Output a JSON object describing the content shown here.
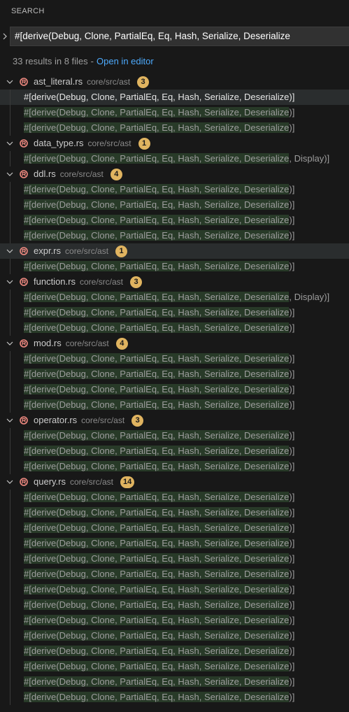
{
  "header": {
    "title": "SEARCH"
  },
  "search": {
    "query": "#[derive(Debug, Clone, PartialEq, Eq, Hash, Serialize, Deserialize"
  },
  "summary": {
    "text": "33 results in 8 files",
    "separator": "-",
    "open_in_editor": "Open in editor"
  },
  "colors": {
    "match_highlight": "#2f3e2e",
    "badge": "#e0b460",
    "link": "#4daafc",
    "error_icon": "#f28b82"
  },
  "groups": [
    {
      "file": "ast_literal.rs",
      "path": "core/src/ast",
      "count": "3",
      "highlighted": false,
      "matches": [
        {
          "match": "#[derive(Debug, Clone, PartialEq, Eq, Hash, Serialize, Deserialize",
          "after": ")]",
          "active": true,
          "highlighted": true
        },
        {
          "match": "#[derive(Debug, Clone, PartialEq, Eq, Hash, Serialize, Deserialize",
          "after": ")]",
          "active": false,
          "highlighted": false
        },
        {
          "match": "#[derive(Debug, Clone, PartialEq, Eq, Hash, Serialize, Deserialize",
          "after": ")]",
          "active": false,
          "highlighted": false
        }
      ]
    },
    {
      "file": "data_type.rs",
      "path": "core/src/ast",
      "count": "1",
      "highlighted": false,
      "matches": [
        {
          "match": "#[derive(Debug, Clone, PartialEq, Eq, Hash, Serialize, Deserialize",
          "after": ", Display)]",
          "active": false,
          "highlighted": false
        }
      ]
    },
    {
      "file": "ddl.rs",
      "path": "core/src/ast",
      "count": "4",
      "highlighted": false,
      "matches": [
        {
          "match": "#[derive(Debug, Clone, PartialEq, Eq, Hash, Serialize, Deserialize",
          "after": ")]",
          "active": false,
          "highlighted": false
        },
        {
          "match": "#[derive(Debug, Clone, PartialEq, Eq, Hash, Serialize, Deserialize",
          "after": ")]",
          "active": false,
          "highlighted": false
        },
        {
          "match": "#[derive(Debug, Clone, PartialEq, Eq, Hash, Serialize, Deserialize",
          "after": ")]",
          "active": false,
          "highlighted": false
        },
        {
          "match": "#[derive(Debug, Clone, PartialEq, Eq, Hash, Serialize, Deserialize",
          "after": ")]",
          "active": false,
          "highlighted": false
        }
      ]
    },
    {
      "file": "expr.rs",
      "path": "core/src/ast",
      "count": "1",
      "highlighted": true,
      "matches": [
        {
          "match": "#[derive(Debug, Clone, PartialEq, Eq, Hash, Serialize, Deserialize",
          "after": ")]",
          "active": false,
          "highlighted": false
        }
      ]
    },
    {
      "file": "function.rs",
      "path": "core/src/ast",
      "count": "3",
      "highlighted": false,
      "matches": [
        {
          "match": "#[derive(Debug, Clone, PartialEq, Eq, Hash, Serialize, Deserialize",
          "after": ", Display)]",
          "active": false,
          "highlighted": false
        },
        {
          "match": "#[derive(Debug, Clone, PartialEq, Eq, Hash, Serialize, Deserialize",
          "after": ")]",
          "active": false,
          "highlighted": false
        },
        {
          "match": "#[derive(Debug, Clone, PartialEq, Eq, Hash, Serialize, Deserialize",
          "after": ")]",
          "active": false,
          "highlighted": false
        }
      ]
    },
    {
      "file": "mod.rs",
      "path": "core/src/ast",
      "count": "4",
      "highlighted": false,
      "matches": [
        {
          "match": "#[derive(Debug, Clone, PartialEq, Eq, Hash, Serialize, Deserialize",
          "after": ")]",
          "active": false,
          "highlighted": false
        },
        {
          "match": "#[derive(Debug, Clone, PartialEq, Eq, Hash, Serialize, Deserialize",
          "after": ")]",
          "active": false,
          "highlighted": false
        },
        {
          "match": "#[derive(Debug, Clone, PartialEq, Eq, Hash, Serialize, Deserialize",
          "after": ")]",
          "active": false,
          "highlighted": false
        },
        {
          "match": "#[derive(Debug, Clone, PartialEq, Eq, Hash, Serialize, Deserialize",
          "after": ")]",
          "active": false,
          "highlighted": false
        }
      ]
    },
    {
      "file": "operator.rs",
      "path": "core/src/ast",
      "count": "3",
      "highlighted": false,
      "matches": [
        {
          "match": "#[derive(Debug, Clone, PartialEq, Eq, Hash, Serialize, Deserialize",
          "after": ")]",
          "active": false,
          "highlighted": false
        },
        {
          "match": "#[derive(Debug, Clone, PartialEq, Eq, Hash, Serialize, Deserialize",
          "after": ")]",
          "active": false,
          "highlighted": false
        },
        {
          "match": "#[derive(Debug, Clone, PartialEq, Eq, Hash, Serialize, Deserialize",
          "after": ")]",
          "active": false,
          "highlighted": false
        }
      ]
    },
    {
      "file": "query.rs",
      "path": "core/src/ast",
      "count": "14",
      "highlighted": false,
      "matches": [
        {
          "match": "#[derive(Debug, Clone, PartialEq, Eq, Hash, Serialize, Deserialize",
          "after": ")]",
          "active": false,
          "highlighted": false
        },
        {
          "match": "#[derive(Debug, Clone, PartialEq, Eq, Hash, Serialize, Deserialize",
          "after": ")]",
          "active": false,
          "highlighted": false
        },
        {
          "match": "#[derive(Debug, Clone, PartialEq, Eq, Hash, Serialize, Deserialize",
          "after": ")]",
          "active": false,
          "highlighted": false
        },
        {
          "match": "#[derive(Debug, Clone, PartialEq, Eq, Hash, Serialize, Deserialize",
          "after": ")]",
          "active": false,
          "highlighted": false
        },
        {
          "match": "#[derive(Debug, Clone, PartialEq, Eq, Hash, Serialize, Deserialize",
          "after": ")]",
          "active": false,
          "highlighted": false
        },
        {
          "match": "#[derive(Debug, Clone, PartialEq, Eq, Hash, Serialize, Deserialize",
          "after": ")]",
          "active": false,
          "highlighted": false
        },
        {
          "match": "#[derive(Debug, Clone, PartialEq, Eq, Hash, Serialize, Deserialize",
          "after": ")]",
          "active": false,
          "highlighted": false
        },
        {
          "match": "#[derive(Debug, Clone, PartialEq, Eq, Hash, Serialize, Deserialize",
          "after": ")]",
          "active": false,
          "highlighted": false
        },
        {
          "match": "#[derive(Debug, Clone, PartialEq, Eq, Hash, Serialize, Deserialize",
          "after": ")]",
          "active": false,
          "highlighted": false
        },
        {
          "match": "#[derive(Debug, Clone, PartialEq, Eq, Hash, Serialize, Deserialize",
          "after": ")]",
          "active": false,
          "highlighted": false
        },
        {
          "match": "#[derive(Debug, Clone, PartialEq, Eq, Hash, Serialize, Deserialize",
          "after": ")]",
          "active": false,
          "highlighted": false
        },
        {
          "match": "#[derive(Debug, Clone, PartialEq, Eq, Hash, Serialize, Deserialize",
          "after": ")]",
          "active": false,
          "highlighted": false
        },
        {
          "match": "#[derive(Debug, Clone, PartialEq, Eq, Hash, Serialize, Deserialize",
          "after": ")]",
          "active": false,
          "highlighted": false
        },
        {
          "match": "#[derive(Debug, Clone, PartialEq, Eq, Hash, Serialize, Deserialize",
          "after": ")]",
          "active": false,
          "highlighted": false
        }
      ]
    }
  ]
}
